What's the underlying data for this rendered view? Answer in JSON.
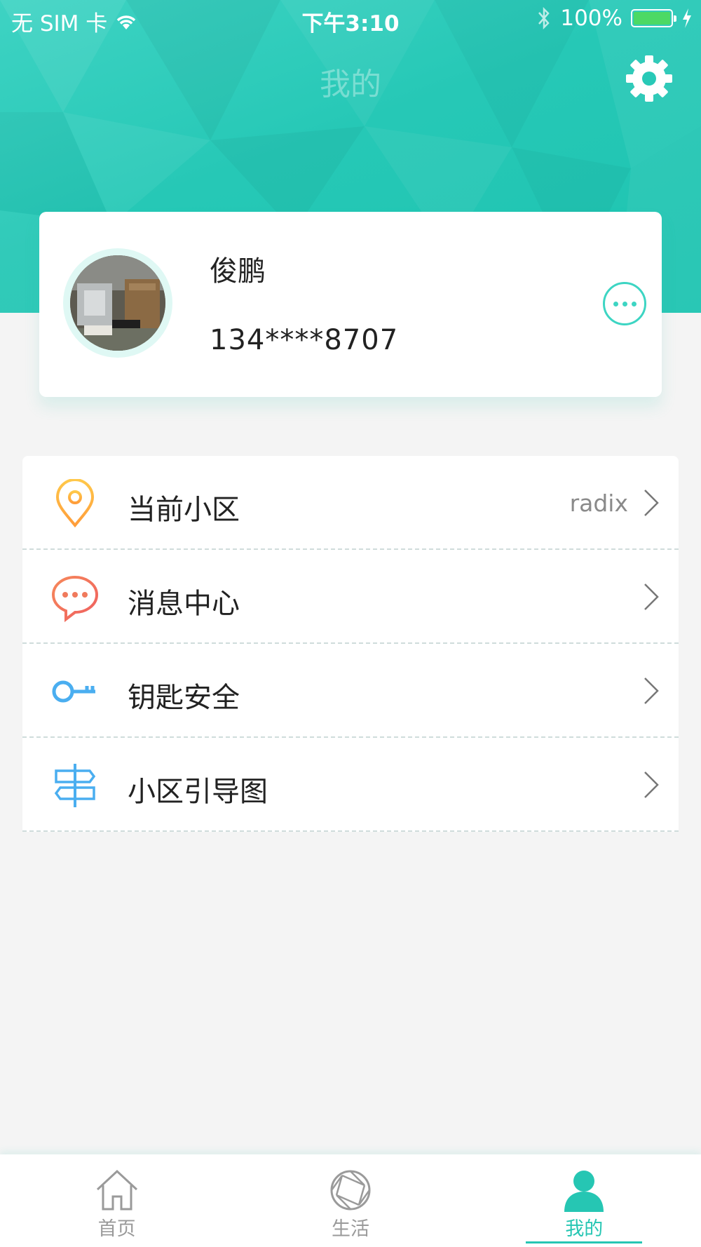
{
  "status_bar": {
    "carrier": "无 SIM 卡",
    "time": "下午3:10",
    "battery_percent": "100%",
    "battery_level": 1.0,
    "battery_color": "#4cd964"
  },
  "header": {
    "title": "我的",
    "settings_icon": "gear-icon",
    "accent_color": "#26c8b6"
  },
  "profile": {
    "name": "俊鹏",
    "phone": "134****8707",
    "more_icon": "more-dots-icon"
  },
  "menu": {
    "items": [
      {
        "label": "当前小区",
        "value": "radix",
        "icon": "location-pin-icon",
        "icon_color": "#ffb840"
      },
      {
        "label": "消息中心",
        "value": "",
        "icon": "chat-bubble-icon",
        "icon_color": "#f07a5c"
      },
      {
        "label": "钥匙安全",
        "value": "",
        "icon": "key-icon",
        "icon_color": "#4aaef0"
      },
      {
        "label": "小区引导图",
        "value": "",
        "icon": "signpost-icon",
        "icon_color": "#4aaef0"
      }
    ]
  },
  "tab_bar": {
    "tabs": [
      {
        "label": "首页",
        "icon": "home-icon",
        "active": false
      },
      {
        "label": "生活",
        "icon": "aperture-icon",
        "active": false
      },
      {
        "label": "我的",
        "icon": "person-icon",
        "active": true
      }
    ],
    "active_color": "#26c6b3"
  }
}
